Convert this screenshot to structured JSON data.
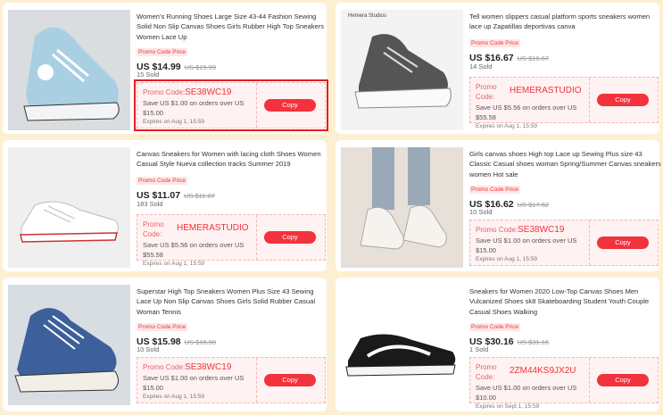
{
  "products": [
    {
      "title": "Women's Running Shoes Large Size 43-44 Fashion Sewing Solid Non Slip Canvas Shoes Girls Rubber High Top Sneakers Women Lace Up",
      "promo_tag": "Promo Code Price",
      "price": "US $14.99",
      "old_price": "US $15.99",
      "sold": "15 Sold",
      "coupon": {
        "code_label": "Promo Code:",
        "code": "SE38WC19",
        "offer": "Save US $1.00 on orders over US $15.00",
        "expires": "Expires on Aug 1, 15:59",
        "copy": "Copy"
      },
      "image_icon": "light-blue-high-top-sneaker",
      "selected": true
    },
    {
      "brand": "Hemera Studios",
      "title": "Tell women slippers casual platform sports sneakers women lace up Zapatillas deportivas canva",
      "promo_tag": "Promo Code Price",
      "price": "US $16.67",
      "old_price": "US $16.67",
      "sold": "14 Sold",
      "coupon": {
        "code_label": "Promo Code:",
        "code": "HEMERASTUDIO",
        "offer": "Save US $5.56 on orders over US $55.58",
        "expires": "Expires on Aug 1, 15:59",
        "copy": "Copy"
      },
      "image_icon": "black-platform-high-top-sneaker"
    },
    {
      "title": "Canvas Sneakers for Women with lacing cloth Shoes Women Casual Style Nueva collection tracks Summer 2019",
      "promo_tag": "Promo Code Price",
      "price": "US $11.07",
      "old_price": "US $11.07",
      "sold": "183 Sold",
      "coupon": {
        "code_label": "Promo Code:",
        "code": "HEMERASTUDIO",
        "offer": "Save US $5.56 on orders over US $55.58",
        "expires": "Expires on Aug 1, 15:59",
        "copy": "Copy"
      },
      "image_icon": "white-low-top-sneaker"
    },
    {
      "title": "Girls canvas shoes High top Lace up Sewing Plus size 43 Classic Casual shoes woman Spring/Summer Canvas sneakers women Hot sale",
      "promo_tag": "Promo Code Price",
      "price": "US $16.62",
      "old_price": "US $17.62",
      "sold": "10 Sold",
      "coupon": {
        "code_label": "Promo Code:",
        "code": "SE38WC19",
        "offer": "Save US $1.00 on orders over US $15.00",
        "expires": "Expires on Aug 1, 15:59",
        "copy": "Copy"
      },
      "image_icon": "white-high-top-sneakers-worn"
    },
    {
      "title": "Superstar High Top Sneakers Women Plus Size 43 Sewing Lace Up Non Slip Canvas Shoes Girls Solid Rubber Casual Woman Tennis",
      "promo_tag": "Promo Code Price",
      "price": "US $15.98",
      "old_price": "US $16.98",
      "sold": "10 Sold",
      "coupon": {
        "code_label": "Promo Code:",
        "code": "SE38WC19",
        "offer": "Save US $1.00 on orders over US $15.00",
        "expires": "Expires on Aug 1, 15:59",
        "copy": "Copy"
      },
      "image_icon": "blue-high-top-sneaker"
    },
    {
      "title": "Sneakers for Women 2020 Low-Top Canvas Shoes Men Vulcanized Shoes sk8 Skateboarding Student Youth Couple Casual Shoes Walking",
      "promo_tag": "Promo Code Price",
      "price": "US $30.16",
      "old_price": "US $31.16",
      "sold": "1 Sold",
      "coupon": {
        "code_label": "Promo Code:",
        "code": "2ZM44KS9JX2U",
        "offer": "Save US $1.00 on orders over US $10.00",
        "expires": "Expires on Sept 1, 15:59",
        "copy": "Copy"
      },
      "image_icon": "black-white-skate-sneaker"
    }
  ]
}
